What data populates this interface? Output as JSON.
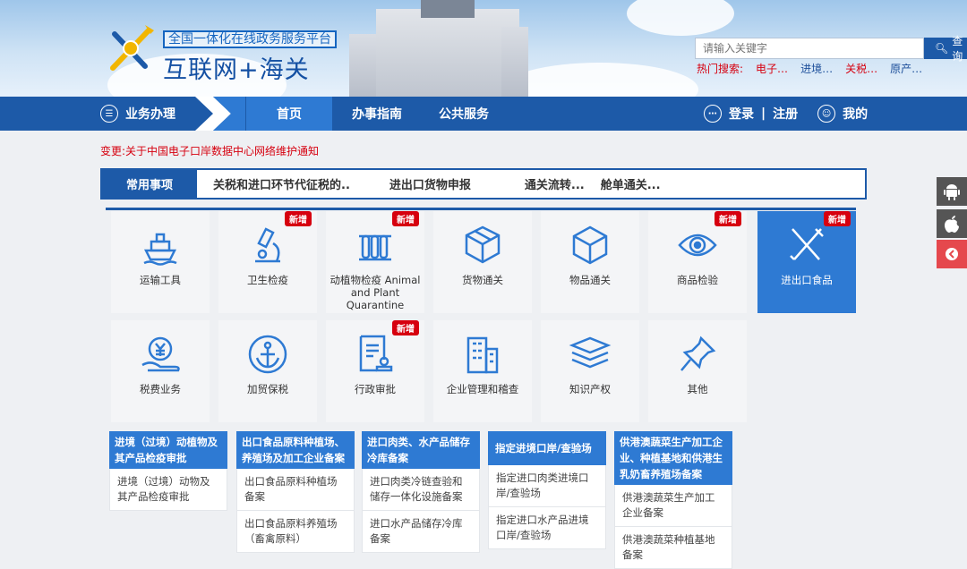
{
  "header": {
    "subtitle": "全国一体化在线政务服务平台",
    "title": "互联网+海关",
    "search_placeholder": "请输入关键字",
    "search_button": "查询",
    "hot_label": "热门搜索:",
    "hot_keywords": [
      "电子…",
      "进境…",
      "关税…",
      "原产…"
    ]
  },
  "nav": {
    "business": "业务办理",
    "home": "首页",
    "guide": "办事指南",
    "public": "公共服务",
    "login": "登录",
    "separator": "|",
    "register": "注册",
    "mine": "我的"
  },
  "notice": "变更:关于中国电子口岸数据中心网络维护通知",
  "tabs": {
    "active": "常用事项",
    "items": [
      "关税和进口环节代征税的..",
      "进出口货物申报",
      "通关流转...",
      "舱单通关..."
    ]
  },
  "tiles": [
    {
      "label": "运输工具",
      "icon": "ship-icon",
      "badge": ""
    },
    {
      "label": "卫生检疫",
      "icon": "microscope-icon",
      "badge": "新增"
    },
    {
      "label": "动植物检疫 Animal and Plant Quarantine",
      "icon": "test-tubes-icon",
      "badge": "新增"
    },
    {
      "label": "货物通关",
      "icon": "package-icon",
      "badge": ""
    },
    {
      "label": "物品通关",
      "icon": "cube-icon",
      "badge": ""
    },
    {
      "label": "商品检验",
      "icon": "eye-icon",
      "badge": "新增"
    },
    {
      "label": "进出口食品",
      "icon": "fork-knife-icon",
      "badge": "新增"
    },
    {
      "label": "税费业务",
      "icon": "yuan-hand-icon",
      "badge": ""
    },
    {
      "label": "加贸保税",
      "icon": "anchor-icon",
      "badge": ""
    },
    {
      "label": "行政审批",
      "icon": "document-stamp-icon",
      "badge": "新增"
    },
    {
      "label": "企业管理和稽查",
      "icon": "building-icon",
      "badge": ""
    },
    {
      "label": "知识产权",
      "icon": "layers-icon",
      "badge": ""
    },
    {
      "label": "其他",
      "icon": "pin-icon",
      "badge": ""
    }
  ],
  "columns": [
    {
      "head": "进境（过境）动植物及其产品检疫审批",
      "items": [
        "进境（过境）动物及其产品检疫审批"
      ]
    },
    {
      "head": "出口食品原料种植场、养殖场及加工企业备案",
      "items": [
        "出口食品原料种植场备案",
        "出口食品原料养殖场（畜禽原料）"
      ]
    },
    {
      "head": "进口肉类、水产品储存冷库备案",
      "items": [
        "进口肉类冷链查验和储存一体化设施备案",
        "进口水产品储存冷库备案"
      ]
    },
    {
      "head": "指定进境口岸/查验场",
      "items": [
        "指定进口肉类进境口岸/查验场",
        "指定进口水产品进境口岸/查验场"
      ]
    },
    {
      "head": "供港澳蔬菜生产加工企业、种植基地和供港生乳奶畜养殖场备案",
      "items": [
        "供港澳蔬菜生产加工企业备案",
        "供港澳蔬菜种植基地备案"
      ]
    }
  ],
  "colors": {
    "primary": "#1d5aa8",
    "active": "#2e7ad3",
    "alert": "#d6000f"
  }
}
